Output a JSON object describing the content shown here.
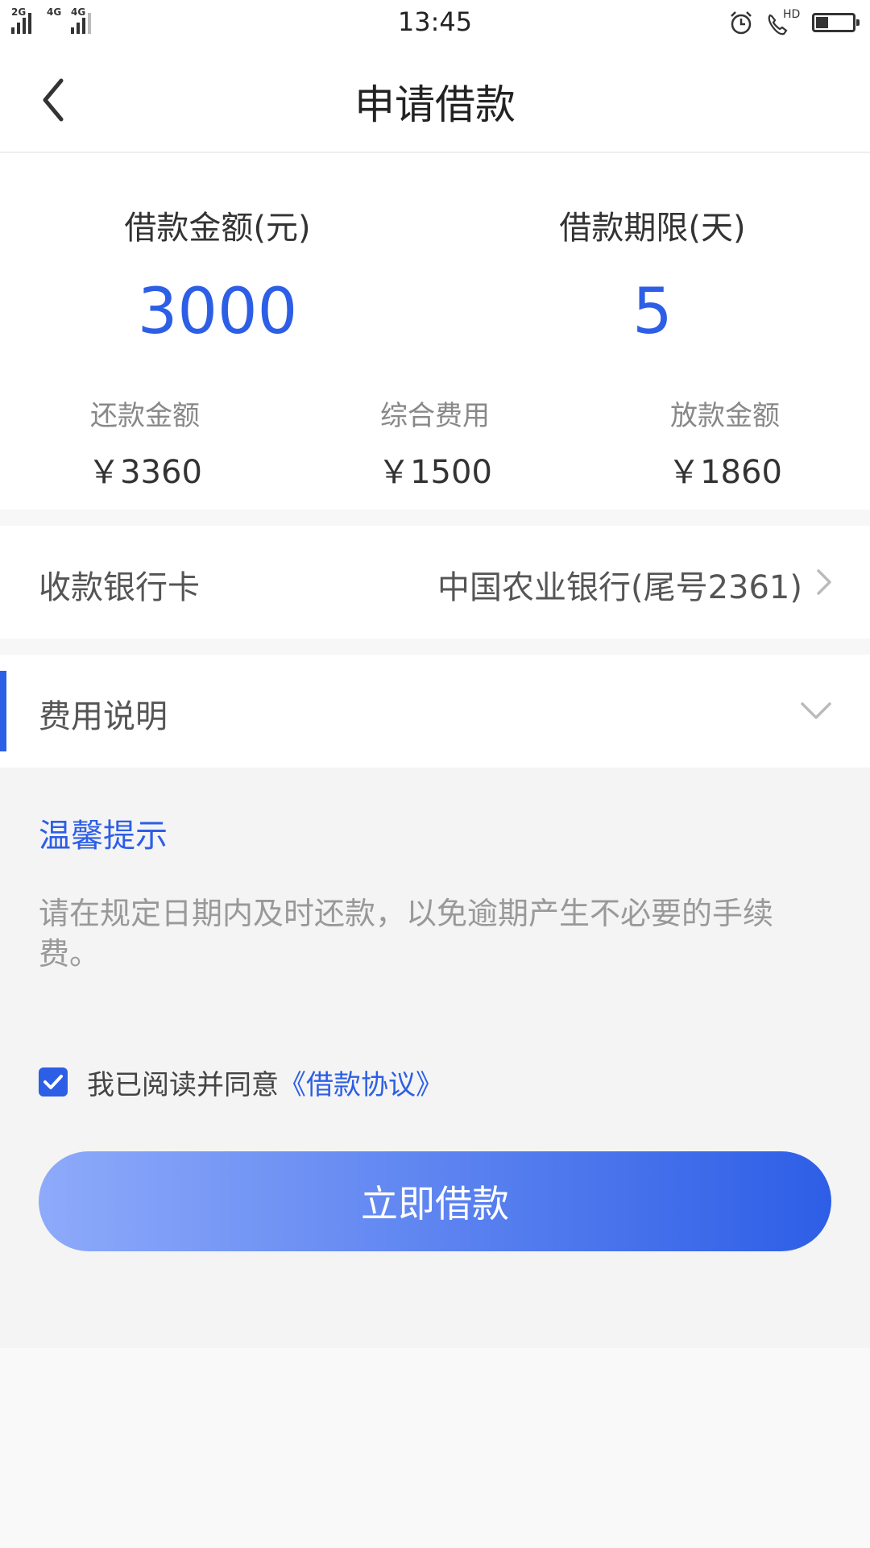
{
  "status_bar": {
    "time": "13:45",
    "network_left": "2G",
    "network_mid_a": "4G",
    "network_mid_b": "4G",
    "call_badge": "HD",
    "battery_level": 0.35,
    "icons": [
      "signal-icon",
      "alarm-icon",
      "phone-hd-icon",
      "battery-icon"
    ]
  },
  "header": {
    "title": "申请借款",
    "back_icon": "back-arrow-icon"
  },
  "summary": {
    "amount_label": "借款金额(元)",
    "amount_value": "3000",
    "term_label": "借款期限(天)",
    "term_value": "5",
    "repay_label": "还款金额",
    "repay_value": "￥3360",
    "fee_label": "综合费用",
    "fee_value": "￥1500",
    "disburse_label": "放款金额",
    "disburse_value": "￥1860"
  },
  "bank": {
    "label": "收款银行卡",
    "value": "中国农业银行(尾号2361)"
  },
  "fee_section": {
    "label": "费用说明"
  },
  "tips": {
    "title": "温馨提示",
    "text": "请在规定日期内及时还款，以免逾期产生不必要的手续费。"
  },
  "agreement": {
    "checked": true,
    "text": "我已阅读并同意",
    "link": "《借款协议》"
  },
  "submit": {
    "label": "立即借款"
  },
  "colors": {
    "accent": "#2d5ee6",
    "button_gradient_start": "#8eaafa",
    "button_gradient_end": "#2d5ee6"
  }
}
